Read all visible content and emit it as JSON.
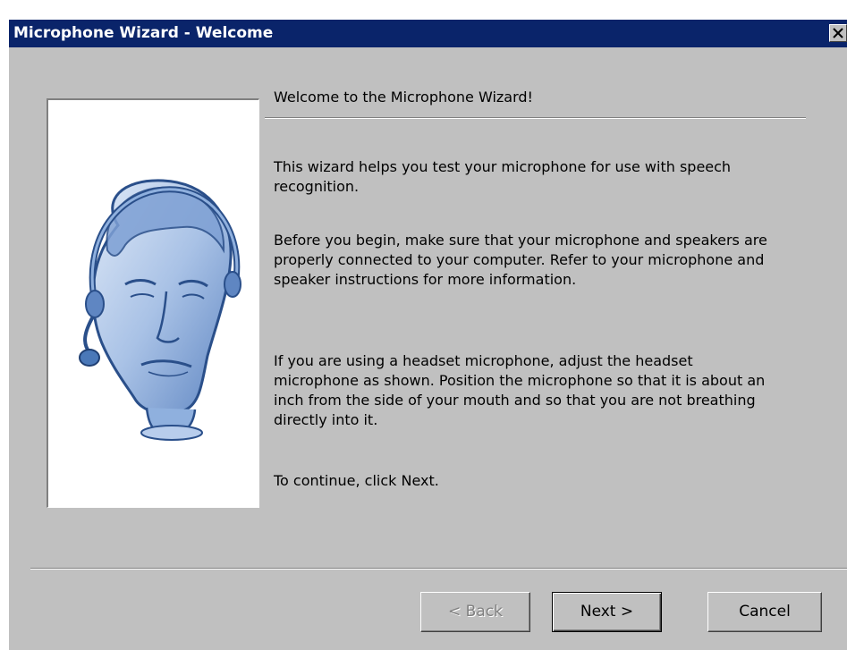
{
  "window": {
    "title": "Microphone Wizard - Welcome"
  },
  "content": {
    "header": "Welcome to the Microphone Wizard!",
    "paragraph1": "This wizard helps you test your microphone for use with speech recognition.",
    "paragraph2": "Before you begin, make sure that your microphone and speakers are properly connected to your computer. Refer to your microphone and speaker instructions for more information.",
    "paragraph3": "If you are using a headset microphone, adjust the headset microphone as shown. Position the microphone so that it is about an inch from the side of your mouth and so that you are not breathing directly into it.",
    "paragraph4": "To continue, click Next."
  },
  "buttons": {
    "back": "< Back",
    "next": "Next >",
    "cancel": "Cancel"
  },
  "colors": {
    "titlebar": "#0a246a",
    "dialog": "#c0c0c0",
    "illustration": "#4a78b8"
  },
  "icons": {
    "close": "close-icon",
    "illustration": "headset-head-illustration"
  }
}
